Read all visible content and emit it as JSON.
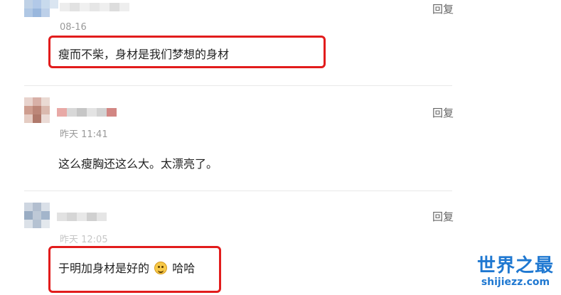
{
  "comments": [
    {
      "date": "08-16",
      "reply_label": "回复",
      "text": "瘦而不柴，身材是我们梦想的身材",
      "highlighted": true
    },
    {
      "date": "昨天 11:41",
      "reply_label": "回复",
      "text": "这么瘦胸还这么大。太漂亮了。",
      "highlighted": false
    },
    {
      "date": "昨天 12:05",
      "reply_label": "回复",
      "text_before_emoji": "于明加身材是好的",
      "emoji": "grinning-face-icon",
      "text_after_emoji": "哈哈",
      "highlighted": true
    }
  ],
  "watermark": {
    "title": "世界之最",
    "url": "shijiezz.com"
  },
  "colors": {
    "highlight": "#e21c1c",
    "meta": "#999999",
    "reply": "#666666",
    "watermark": "#1f78d1"
  }
}
